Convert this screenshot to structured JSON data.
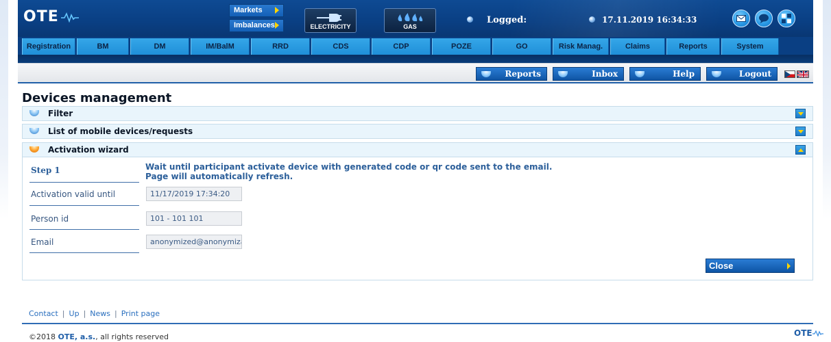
{
  "header": {
    "logo_text": "OTE",
    "markets_label": "Markets",
    "imbalances_label": "Imbalances",
    "electricity_label": "ELECTRICITY",
    "gas_label": "GAS",
    "logged_label": "Logged:",
    "datetime": "17.11.2019 16:34:33",
    "icons": [
      "mail-icon",
      "chat-icon",
      "puzzle-icon"
    ]
  },
  "nav": {
    "items": [
      {
        "label": "Registration"
      },
      {
        "label": "BM"
      },
      {
        "label": "DM"
      },
      {
        "label": "IM/BalM"
      },
      {
        "label": "RRD"
      },
      {
        "label": "CDS"
      },
      {
        "label": "CDP"
      },
      {
        "label": "POZE"
      },
      {
        "label": "GO"
      },
      {
        "label": "Risk Manag."
      },
      {
        "label": "Claims"
      },
      {
        "label": "Reports"
      },
      {
        "label": "System"
      }
    ]
  },
  "toolbar": {
    "reports": "Reports",
    "inbox": "Inbox",
    "help": "Help",
    "logout": "Logout"
  },
  "page": {
    "title": "Devices management",
    "panels": {
      "filter": "Filter",
      "list": "List of mobile devices/requests",
      "wizard": "Activation wizard"
    },
    "wizard": {
      "step": "Step 1",
      "message": "Wait until participant activate device with generated code or qr code sent to the email. Page will automatically refresh.",
      "fields": [
        {
          "label": "Activation valid until",
          "value": "11/17/2019 17:34:20"
        },
        {
          "label": "Person id",
          "value": "101 - 101 101"
        },
        {
          "label": "Email",
          "value": "anonymized@anonymization"
        }
      ],
      "close_label": "Close"
    }
  },
  "footer": {
    "links": [
      "Contact",
      "Up",
      "News",
      "Print page"
    ],
    "copyright_prefix": "©2018 ",
    "copyright_company": "OTE, a.s.",
    "copyright_suffix": ", all rights reserved",
    "logo_text": "OTE"
  },
  "colors": {
    "header_bg": "#0a3f83",
    "nav_item": "#1f8fd8",
    "panel_bg": "#e9f5fc",
    "accent_yellow": "#ffd400"
  }
}
